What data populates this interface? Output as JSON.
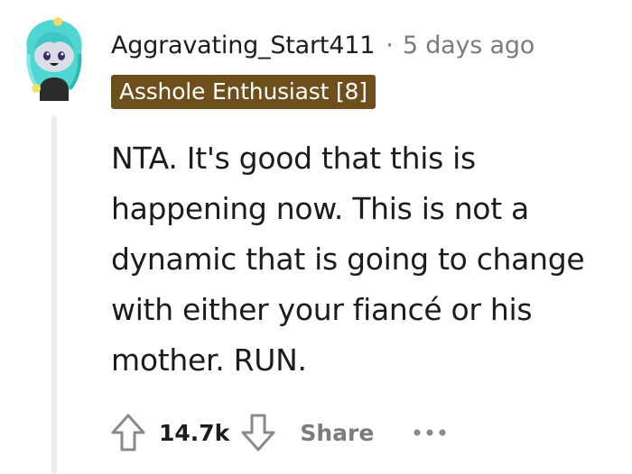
{
  "comment": {
    "avatar_icon": "snoo-avatar-icon",
    "username": "Aggravating_Start411",
    "separator": "·",
    "timestamp": "5 days ago",
    "flair": "Asshole Enthusiast [8]",
    "flair_color": "#6e4f1b",
    "body_lines": [
      "NTA. It's good that this is",
      "happening now. This is not a",
      "dynamic that is going to change",
      "with either your fiancé or his",
      "mother. RUN."
    ]
  },
  "actions": {
    "upvote_icon": "arrow-up-icon",
    "score": "14.7k",
    "downvote_icon": "arrow-down-icon",
    "share_label": "Share",
    "more_icon": "more-horizontal-icon"
  }
}
